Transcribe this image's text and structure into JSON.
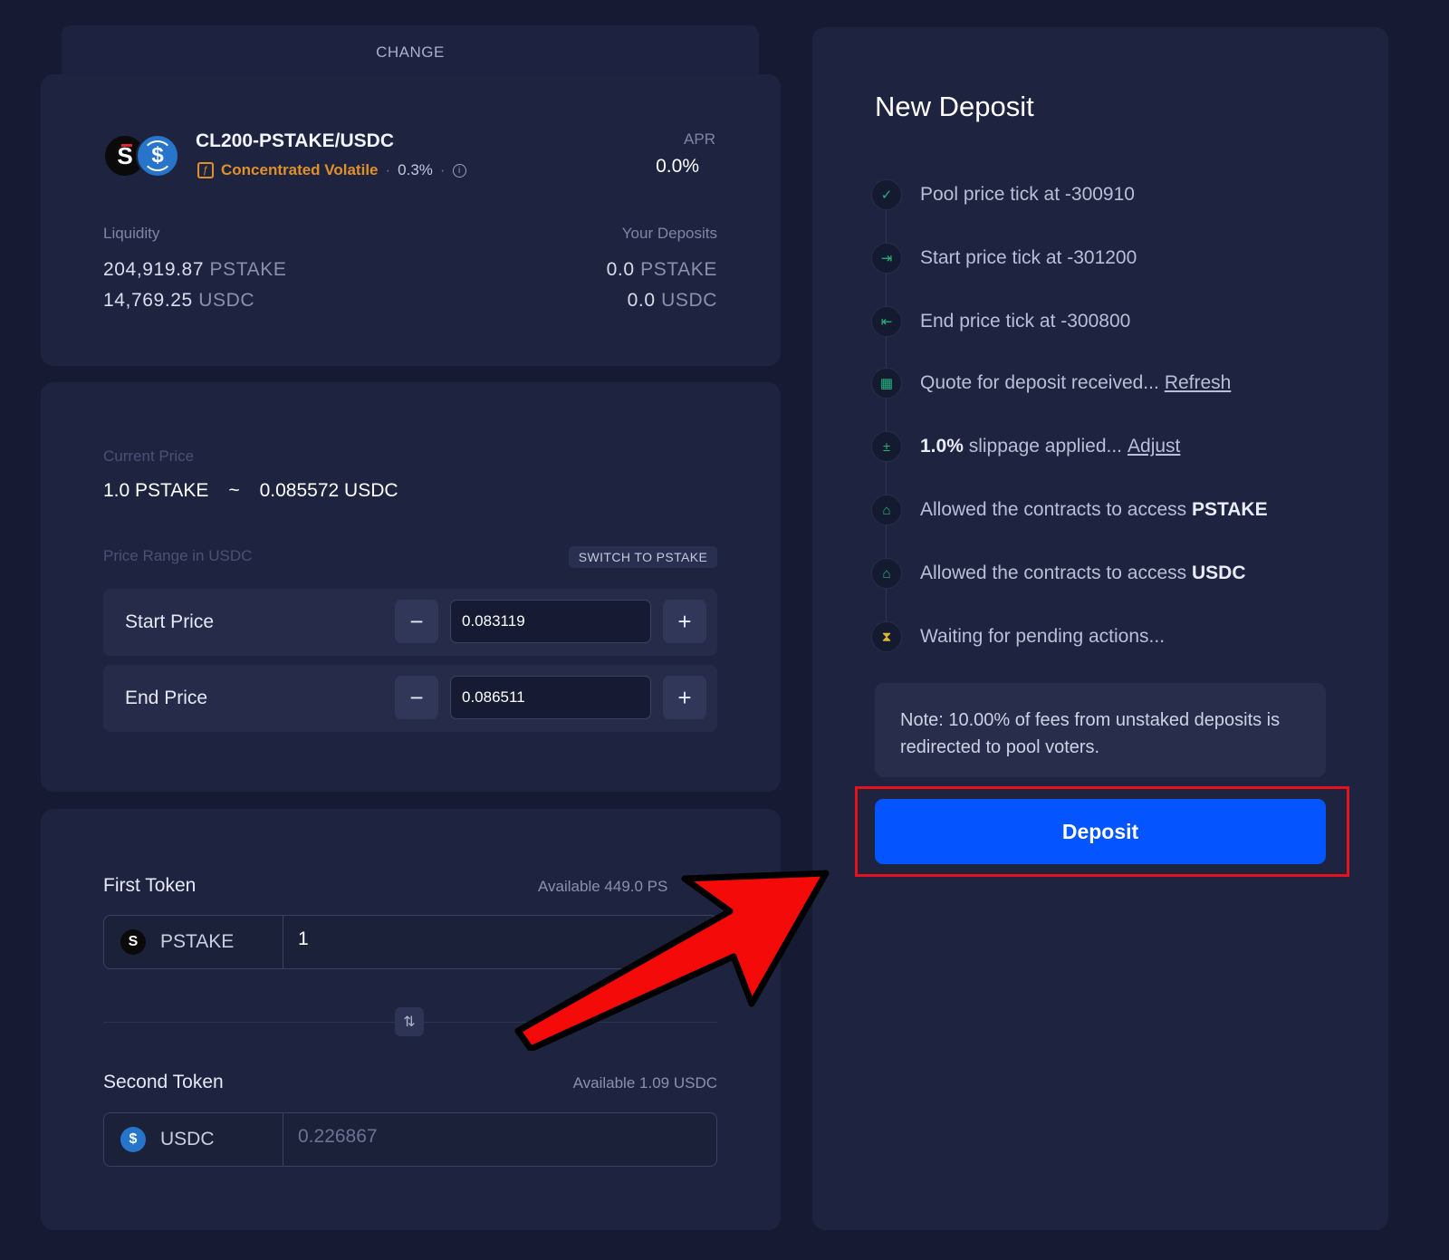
{
  "change_tab": {
    "label": "CHANGE"
  },
  "pool": {
    "name": "CL200-PSTAKE/USDC",
    "type_label": "Concentrated Volatile",
    "fee": "0.3%",
    "apr_label": "APR",
    "apr_value": "0.0%",
    "liquidity_label": "Liquidity",
    "liquidity": [
      {
        "amount": "204,919.87",
        "unit": "PSTAKE"
      },
      {
        "amount": "14,769.25",
        "unit": "USDC"
      }
    ],
    "deposits_label": "Your Deposits",
    "deposits": [
      {
        "amount": "0.0",
        "unit": "PSTAKE"
      },
      {
        "amount": "0.0",
        "unit": "USDC"
      }
    ]
  },
  "price": {
    "current_label": "Current Price",
    "current_left": "1.0 PSTAKE",
    "current_sep": "~",
    "current_right": "0.085572 USDC",
    "range_label": "Price Range in USDC",
    "switch_label": "SWITCH TO PSTAKE",
    "start_label": "Start Price",
    "start_value": "0.083119",
    "end_label": "End Price",
    "end_value": "0.086511",
    "minus": "−",
    "plus": "+"
  },
  "tokens": {
    "first_label": "First Token",
    "first_available": "Available 449.0 PS",
    "first_symbol": "PSTAKE",
    "first_amount": "1",
    "second_label": "Second Token",
    "second_available": "Available 1.09 USDC",
    "second_symbol": "USDC",
    "second_amount": "0.226867"
  },
  "deposit_panel": {
    "title": "New Deposit",
    "steps": [
      {
        "icon": "check-icon",
        "pre": "Pool price tick at -300910"
      },
      {
        "icon": "log-out-icon",
        "pre": "Start price tick at -301200"
      },
      {
        "icon": "log-in-icon",
        "pre": "End price tick at -300800"
      },
      {
        "icon": "calculator-icon",
        "pre": "Quote for deposit received...",
        "link": "Refresh"
      },
      {
        "icon": "plus-minus-icon",
        "bold": "1.0%",
        "pre": " slippage applied...",
        "link": "Adjust"
      },
      {
        "icon": "unlock-icon",
        "pre": "Allowed the contracts to access ",
        "bold": "PSTAKE"
      },
      {
        "icon": "unlock-icon",
        "pre": "Allowed the contracts to access ",
        "bold": "USDC"
      },
      {
        "icon": "hourglass-icon",
        "pre": "Waiting for pending actions..."
      }
    ],
    "note": "Note: 10.00% of fees from unstaked deposits is redirected to pool voters.",
    "deposit_label": "Deposit"
  },
  "colors": {
    "background": "#161b33",
    "panel": "#1e2440",
    "accent_blue": "#0454ff",
    "amber": "#e0902b",
    "success_green": "#24b47e",
    "highlight_red": "#e8101b"
  }
}
